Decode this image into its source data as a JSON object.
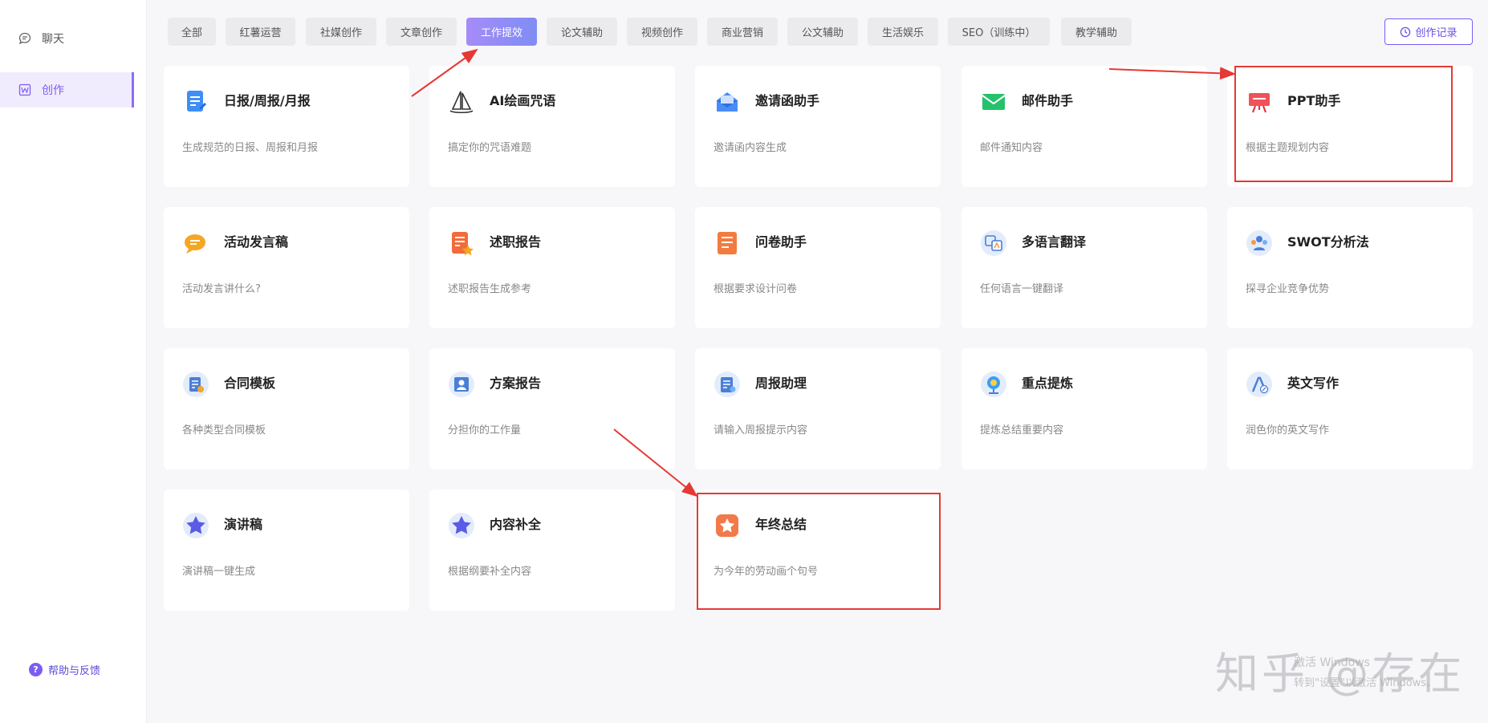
{
  "sidebar": {
    "items": [
      {
        "label": "聊天",
        "icon": "chat-icon"
      },
      {
        "label": "创作",
        "icon": "write-icon"
      }
    ],
    "help_label": "帮助与反馈"
  },
  "tabs": [
    "全部",
    "红薯运营",
    "社媒创作",
    "文章创作",
    "工作提效",
    "论文辅助",
    "视频创作",
    "商业营销",
    "公文辅助",
    "生活娱乐",
    "SEO（训练中）",
    "教学辅助"
  ],
  "active_tab": "工作提效",
  "record_button": "创作记录",
  "cards": [
    {
      "title": "日报/周报/月报",
      "desc": "生成规范的日报、周报和月报",
      "icon": "report-doc-icon"
    },
    {
      "title": "AI绘画咒语",
      "desc": "搞定你的咒语难题",
      "icon": "sailboat-icon"
    },
    {
      "title": "邀请函助手",
      "desc": "邀请函内容生成",
      "icon": "invitation-icon"
    },
    {
      "title": "邮件助手",
      "desc": "邮件通知内容",
      "icon": "mail-icon"
    },
    {
      "title": "PPT助手",
      "desc": "根据主题规划内容",
      "icon": "presentation-icon"
    },
    {
      "title": "活动发言稿",
      "desc": "活动发言讲什么?",
      "icon": "speech-bubble-icon"
    },
    {
      "title": "述职报告",
      "desc": "述职报告生成参考",
      "icon": "report-star-icon"
    },
    {
      "title": "问卷助手",
      "desc": "根据要求设计问卷",
      "icon": "questionnaire-icon"
    },
    {
      "title": "多语言翻译",
      "desc": "任何语言一键翻译",
      "icon": "translate-icon"
    },
    {
      "title": "SWOT分析法",
      "desc": "探寻企业竞争优势",
      "icon": "team-icon"
    },
    {
      "title": "合同模板",
      "desc": "各种类型合同模板",
      "icon": "contract-icon"
    },
    {
      "title": "方案报告",
      "desc": "分担你的工作量",
      "icon": "plan-user-icon"
    },
    {
      "title": "周报助理",
      "desc": "请输入周报提示内容",
      "icon": "weekly-doc-icon"
    },
    {
      "title": "重点提炼",
      "desc": "提炼总结重要内容",
      "icon": "globe-icon"
    },
    {
      "title": "英文写作",
      "desc": "润色你的英文写作",
      "icon": "english-pen-icon"
    },
    {
      "title": "演讲稿",
      "desc": "演讲稿一键生成",
      "icon": "star-badge-icon"
    },
    {
      "title": "内容补全",
      "desc": "根据纲要补全内容",
      "icon": "star-badge-icon"
    },
    {
      "title": "年终总结",
      "desc": "为今年的劳动画个句号",
      "icon": "orange-star-icon"
    }
  ],
  "watermark": {
    "main": "知乎 @存在",
    "line1": "激活 Windows",
    "line2": "转到\"设置\"以激活 Windows。"
  },
  "colors": {
    "accent": "#7b5cf5",
    "annotation": "#e53935"
  }
}
